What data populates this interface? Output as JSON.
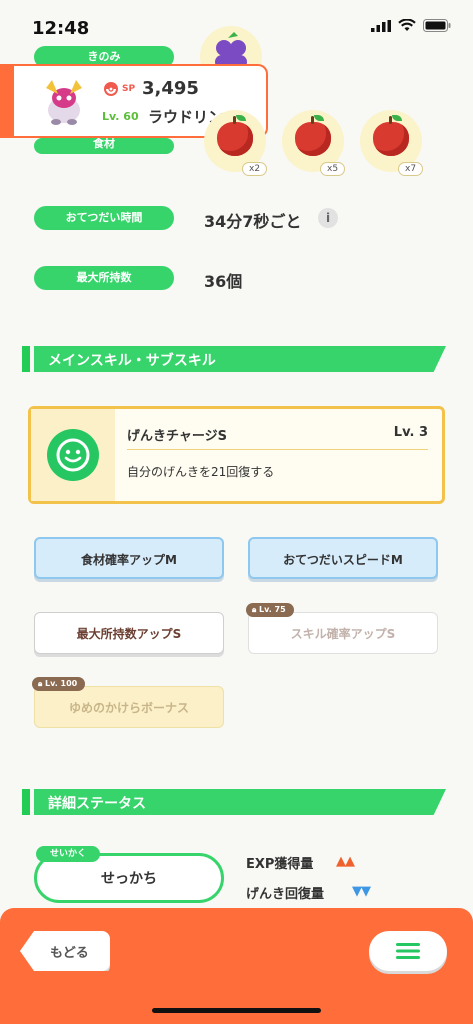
{
  "status": {
    "time": "12:48"
  },
  "pokemon": {
    "sp_label": "SP",
    "sp_value": "3,495",
    "level": "Lv. 60",
    "name": "ラウドリン"
  },
  "berry_label": "きのみ",
  "ingredients_label": "食材",
  "ingredients": [
    {
      "count": "x2"
    },
    {
      "count": "x5"
    },
    {
      "count": "x7"
    }
  ],
  "help_time": {
    "label": "おてつだい時間",
    "value": "34分7秒ごと"
  },
  "max_carry": {
    "label": "最大所持数",
    "value": "36個"
  },
  "section_skills": "メインスキル・サブスキル",
  "main_skill": {
    "name": "げんきチャージS",
    "level": "Lv. 3",
    "desc": "自分のげんきを21回復する"
  },
  "sub_skills": [
    {
      "label": "食材確率アップM"
    },
    {
      "label": "おてつだいスピードM"
    },
    {
      "label": "最大所持数アップS"
    },
    {
      "label": "スキル確率アップS",
      "lock": "Lv. 75"
    },
    {
      "label": "ゆめのかけらボーナス",
      "lock": "Lv. 100"
    }
  ],
  "section_stats": "詳細ステータス",
  "nature": {
    "tag": "せいかく",
    "value": "せっかち"
  },
  "stat_effects": [
    {
      "label": "EXP獲得量",
      "arrows": "▲▲"
    },
    {
      "label": "げんき回復量",
      "arrows": "▼▼"
    }
  ],
  "footer": {
    "back_label": "もどる"
  }
}
